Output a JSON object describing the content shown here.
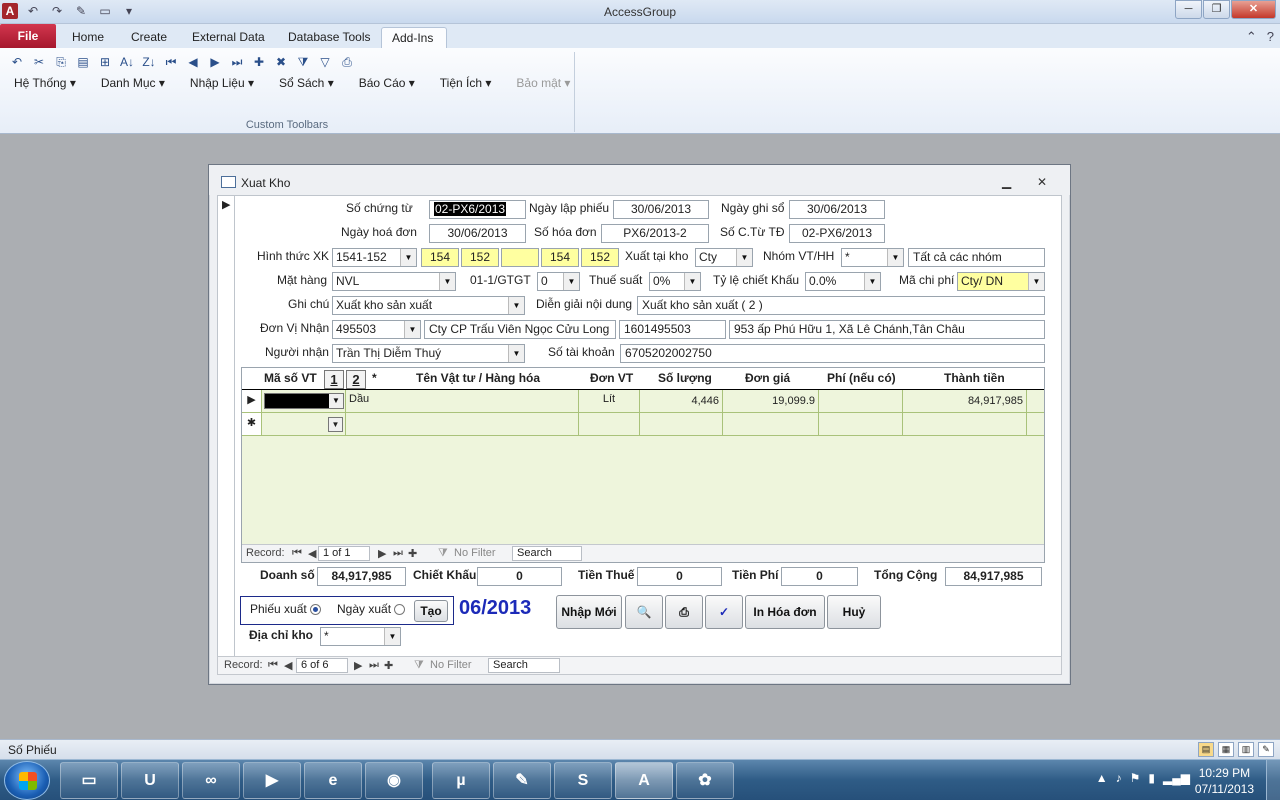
{
  "window": {
    "title": "AccessGroup",
    "app_icon": "A"
  },
  "ribbon": {
    "tabs": [
      "File",
      "Home",
      "Create",
      "External Data",
      "Database Tools",
      "Add-Ins"
    ],
    "active_tab": "Add-Ins",
    "menus": [
      "Hệ Thống",
      "Danh Mục",
      "Nhập Liệu",
      "Sổ Sách",
      "Báo Cáo",
      "Tiện Ích",
      "Bảo mật"
    ],
    "group_caption": "Custom Toolbars"
  },
  "form": {
    "title": "Xuat Kho",
    "labels": {
      "so_chung_tu": "Số chứng từ",
      "ngay_lap_phieu": "Ngày lập phiếu",
      "ngay_ghi_so": "Ngày ghi sổ",
      "ngay_hoa_don": "Ngày hoá đơn",
      "so_hoa_don": "Số hóa đơn",
      "so_ct_td": "Số C.Từ TĐ",
      "hinh_thuc_xk": "Hình thức XK",
      "xuat_tai_kho": "Xuất tại kho",
      "nhom_vt_hh": "Nhóm VT/HH",
      "mat_hang": "Mặt hàng",
      "gtgt": "01-1/GTGT",
      "thue_suat": "Thuế suất",
      "ty_le_ck": "Tỷ lệ chiết Khấu",
      "ma_chi_phi": "Mã chi phí",
      "ghi_chu": "Ghi chú",
      "dien_giai": "Diễn giải nội dung",
      "don_vi_nhan": "Đơn Vị Nhận",
      "nguoi_nhan": "Người nhận",
      "so_tai_khoan": "Số tài khoản"
    },
    "values": {
      "so_chung_tu": "02-PX6/2013",
      "ngay_lap_phieu": "30/06/2013",
      "ngay_ghi_so": "30/06/2013",
      "ngay_hoa_don": "30/06/2013",
      "so_hoa_don": "PX6/2013-2",
      "so_ct_td": "02-PX6/2013",
      "hinh_thuc_xk": "1541-152",
      "tk1": "154",
      "tk2": "152",
      "tk3": "",
      "tk4": "154",
      "tk5": "152",
      "xuat_tai_kho": "Cty",
      "nhom_vt_hh": "*",
      "nhom_desc": "Tất cả các nhóm",
      "mat_hang": "NVL",
      "gtgt": "0",
      "thue_suat": "0%",
      "ty_le_ck": "0.0%",
      "ma_chi_phi": "Cty/ DN",
      "ghi_chu": "Xuất kho sản xuất",
      "dien_giai": "Xuất kho sản xuất ( 2 )",
      "don_vi_nhan": "495503",
      "don_vi_ten": "Cty CP Trấu Viên Ngọc Cửu Long",
      "ma_so_thue": "1601495503",
      "dia_chi": "953 ấp Phú Hữu 1, Xã Lê Chánh,Tân Châu",
      "nguoi_nhan": "Trần Thị Diễm Thuý",
      "so_tai_khoan": "6705202002750"
    },
    "grid": {
      "headers": [
        "Mã số VT",
        "Tên Vật tư / Hàng hóa",
        "Đơn VT",
        "Số lượng",
        "Đơn giá",
        "Phí (nếu có)",
        "Thành tiền"
      ],
      "page_buttons": [
        "1",
        "2",
        "*"
      ],
      "rows": [
        {
          "ten": "Dầu",
          "don_vt": "Lít",
          "so_luong": "4,446",
          "don_gia": "19,099.9",
          "phi": "",
          "thanh_tien": "84,917,985"
        }
      ],
      "nav": {
        "label": "Record:",
        "position": "1 of 1",
        "filter": "No Filter",
        "search": "Search"
      }
    },
    "totals": {
      "doanh_so_label": "Doanh số",
      "doanh_so": "84,917,985",
      "chiet_khau_label": "Chiết Khấu",
      "chiet_khau": "0",
      "tien_thue_label": "Tiền Thuế",
      "tien_thue": "0",
      "tien_phi_label": "Tiền Phí",
      "tien_phi": "0",
      "tong_cong_label": "Tổng Cộng",
      "tong_cong": "84,917,985"
    },
    "bottom": {
      "phieu_xuat": "Phiếu xuất",
      "ngay_xuat": "Ngày xuất",
      "tao": "Tạo",
      "period": "06/2013",
      "nhap_moi": "Nhập Mới",
      "in_hoa_don": "In Hóa đơn",
      "huy": "Huỷ",
      "dia_chi_kho_label": "Địa chỉ kho",
      "dia_chi_kho": "*"
    },
    "nav": {
      "label": "Record:",
      "position": "6 of 6",
      "filter": "No Filter",
      "search": "Search"
    }
  },
  "status": {
    "text": "Số Phiếu"
  },
  "clock": {
    "time": "10:29 PM",
    "date": "07/11/2013"
  },
  "colors": {
    "field_yellow": "#ffffa0",
    "grid_green": "#eef5dc",
    "period_blue": "#1c2ab8",
    "file_tab": "#c42840"
  }
}
